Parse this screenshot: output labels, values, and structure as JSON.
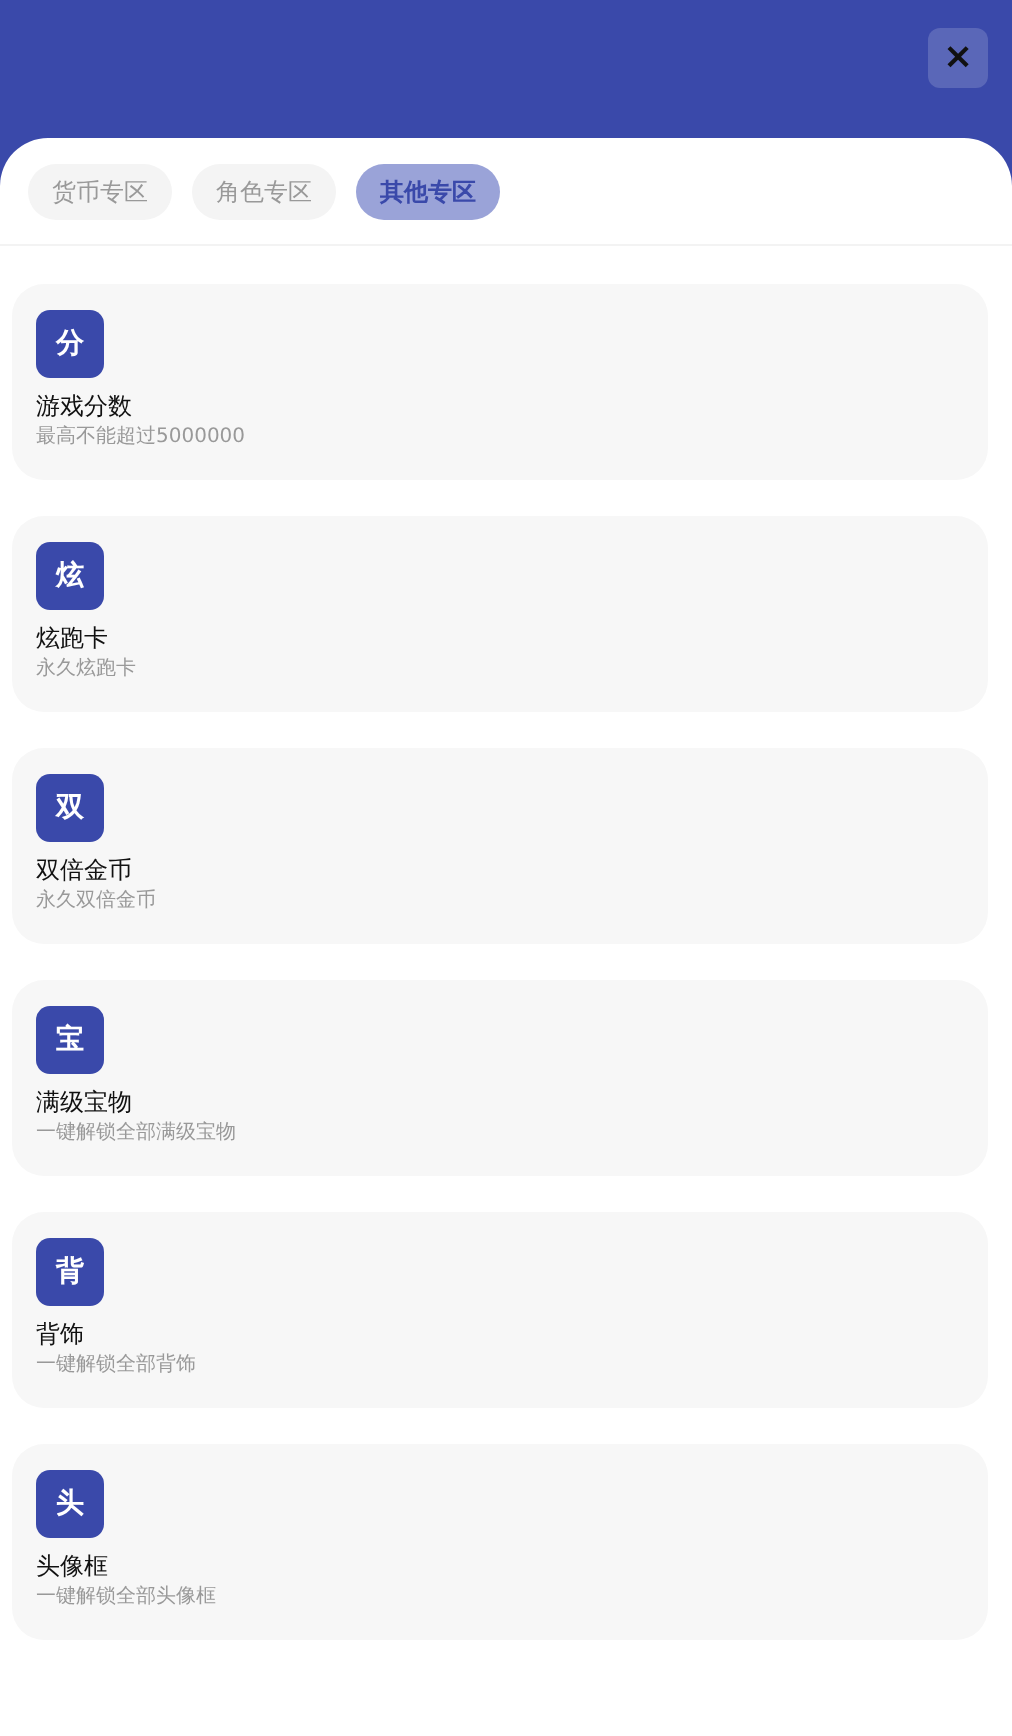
{
  "close_button": {
    "label": "×"
  },
  "tabs": [
    {
      "label": "货币专区",
      "selected": false
    },
    {
      "label": "角色专区",
      "selected": false
    },
    {
      "label": "其他专区",
      "selected": true
    }
  ],
  "items": [
    {
      "badge": "分",
      "title": "游戏分数",
      "subtitle": "最高不能超过5000000"
    },
    {
      "badge": "炫",
      "title": "炫跑卡",
      "subtitle": "永久炫跑卡"
    },
    {
      "badge": "双",
      "title": "双倍金币",
      "subtitle": "永久双倍金币"
    },
    {
      "badge": "宝",
      "title": "满级宝物",
      "subtitle": "一键解锁全部满级宝物"
    },
    {
      "badge": "背",
      "title": "背饰",
      "subtitle": "一键解锁全部背饰"
    },
    {
      "badge": "头",
      "title": "头像框",
      "subtitle": "一键解锁全部头像框"
    }
  ]
}
